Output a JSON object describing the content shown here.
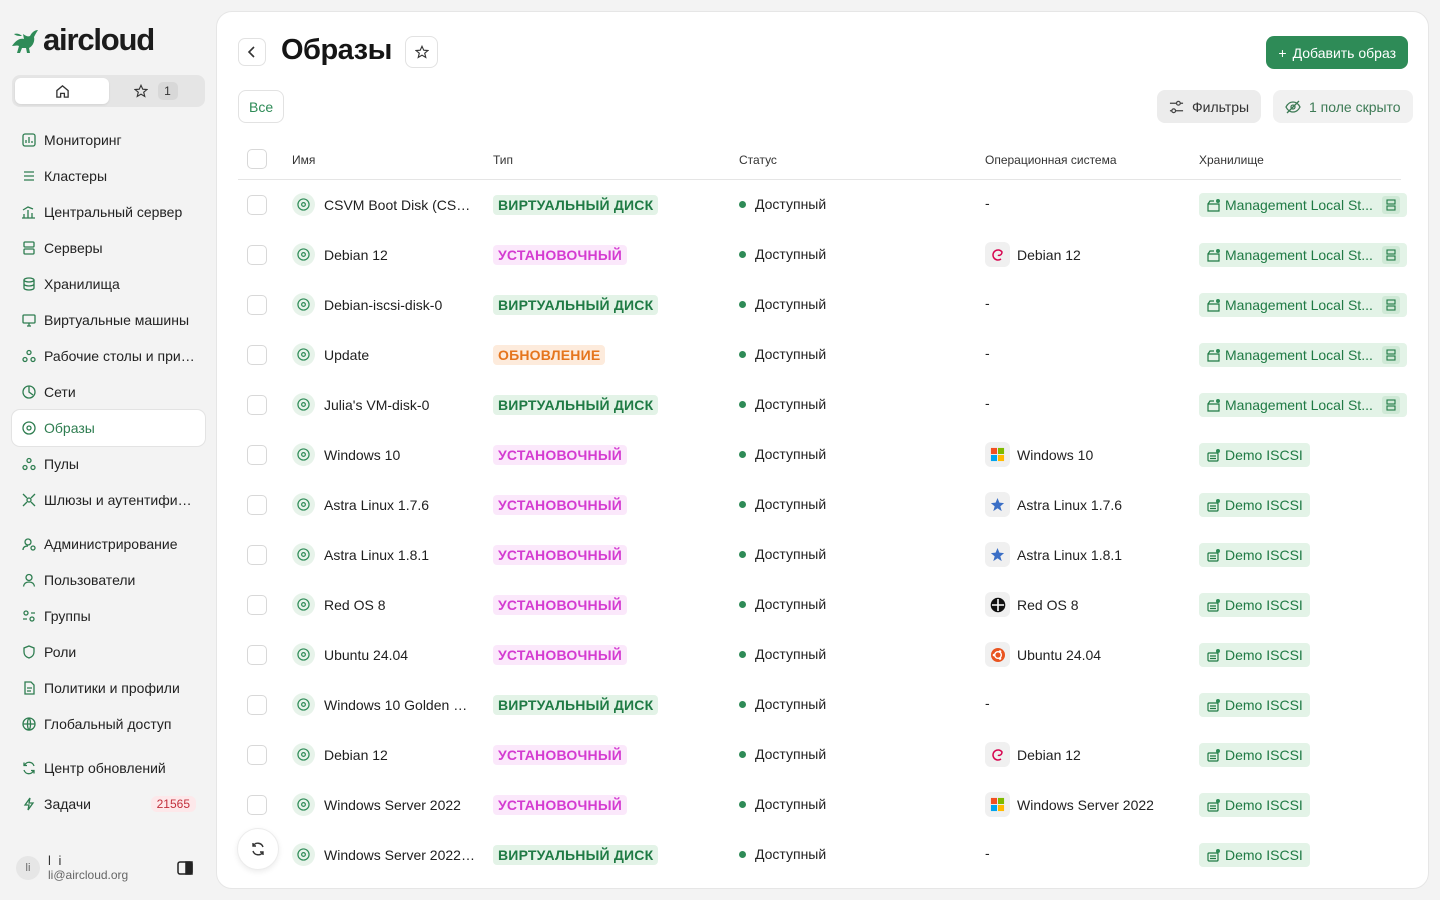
{
  "app": {
    "logo_text": "aircloud"
  },
  "topnav": {
    "favorites_count": "1"
  },
  "sidebar": {
    "items": [
      {
        "label": "Мониторинг",
        "icon": "chart-icon"
      },
      {
        "label": "Кластеры",
        "icon": "layers-icon"
      },
      {
        "label": "Центральный сервер",
        "icon": "central-server-icon"
      },
      {
        "label": "Серверы",
        "icon": "server-icon"
      },
      {
        "label": "Хранилища",
        "icon": "database-icon"
      },
      {
        "label": "Виртуальные машины",
        "icon": "monitor-icon"
      },
      {
        "label": "Рабочие столы и прил...",
        "icon": "desktops-icon"
      },
      {
        "label": "Сети",
        "icon": "network-icon"
      },
      {
        "label": "Образы",
        "icon": "image-icon",
        "active": true
      },
      {
        "label": "Пулы",
        "icon": "pools-icon"
      },
      {
        "label": "Шлюзы и аутентифика...",
        "icon": "gateway-icon"
      },
      {
        "label": "Администрирование",
        "icon": "admin-icon"
      },
      {
        "label": "Пользователи",
        "icon": "user-icon"
      },
      {
        "label": "Группы",
        "icon": "groups-icon"
      },
      {
        "label": "Роли",
        "icon": "shield-icon"
      },
      {
        "label": "Политики и профили",
        "icon": "policy-icon"
      },
      {
        "label": "Глобальный доступ",
        "icon": "globe-icon"
      },
      {
        "label": "Центр обновлений",
        "icon": "refresh-icon"
      },
      {
        "label": "Задачи",
        "icon": "bolt-icon",
        "badge": "21565"
      }
    ]
  },
  "user": {
    "initials": "li",
    "name": "l i",
    "email": "li@aircloud.org"
  },
  "page": {
    "title": "Образы",
    "add_button": "Добавить образ",
    "tab_all": "Все",
    "filters_button": "Фильтры",
    "hidden_fields_button": "1 поле скрыто"
  },
  "table": {
    "columns": [
      "Имя",
      "Тип",
      "Статус",
      "Операционная система",
      "Хранилище"
    ],
    "rows": [
      {
        "name": "CSVM Boot Disk (CSVM ...",
        "type": "ВИРТУАЛЬНЫЙ ДИСК",
        "type_kind": "disk",
        "status": "Доступный",
        "os": "-",
        "os_icon": "",
        "storage": "Management Local St...",
        "storage_kind": "local"
      },
      {
        "name": "Debian 12",
        "type": "УСТАНОВОЧНЫЙ",
        "type_kind": "inst",
        "status": "Доступный",
        "os": "Debian 12",
        "os_icon": "debian-icon",
        "storage": "Management Local St...",
        "storage_kind": "local"
      },
      {
        "name": "Debian-iscsi-disk-0",
        "type": "ВИРТУАЛЬНЫЙ ДИСК",
        "type_kind": "disk",
        "status": "Доступный",
        "os": "-",
        "os_icon": "",
        "storage": "Management Local St...",
        "storage_kind": "local"
      },
      {
        "name": "Update",
        "type": "ОБНОВЛЕНИЕ",
        "type_kind": "upd",
        "status": "Доступный",
        "os": "-",
        "os_icon": "",
        "storage": "Management Local St...",
        "storage_kind": "local"
      },
      {
        "name": "Julia's VM-disk-0",
        "type": "ВИРТУАЛЬНЫЙ ДИСК",
        "type_kind": "disk",
        "status": "Доступный",
        "os": "-",
        "os_icon": "",
        "storage": "Management Local St...",
        "storage_kind": "local"
      },
      {
        "name": "Windows 10",
        "type": "УСТАНОВОЧНЫЙ",
        "type_kind": "inst",
        "status": "Доступный",
        "os": "Windows 10",
        "os_icon": "windows-icon",
        "storage": "Demo ISCSI",
        "storage_kind": "iscsi"
      },
      {
        "name": "Astra Linux 1.7.6",
        "type": "УСТАНОВОЧНЫЙ",
        "type_kind": "inst",
        "status": "Доступный",
        "os": "Astra Linux 1.7.6",
        "os_icon": "astra-icon",
        "storage": "Demo ISCSI",
        "storage_kind": "iscsi"
      },
      {
        "name": "Astra Linux 1.8.1",
        "type": "УСТАНОВОЧНЫЙ",
        "type_kind": "inst",
        "status": "Доступный",
        "os": "Astra Linux 1.8.1",
        "os_icon": "astra-icon",
        "storage": "Demo ISCSI",
        "storage_kind": "iscsi"
      },
      {
        "name": "Red OS 8",
        "type": "УСТАНОВОЧНЫЙ",
        "type_kind": "inst",
        "status": "Доступный",
        "os": "Red OS 8",
        "os_icon": "redos-icon",
        "storage": "Demo ISCSI",
        "storage_kind": "iscsi"
      },
      {
        "name": "Ubuntu 24.04",
        "type": "УСТАНОВОЧНЫЙ",
        "type_kind": "inst",
        "status": "Доступный",
        "os": "Ubuntu 24.04",
        "os_icon": "ubuntu-icon",
        "storage": "Demo ISCSI",
        "storage_kind": "iscsi"
      },
      {
        "name": "Windows 10 Golden VM...",
        "type": "ВИРТУАЛЬНЫЙ ДИСК",
        "type_kind": "disk",
        "status": "Доступный",
        "os": "-",
        "os_icon": "",
        "storage": "Demo ISCSI",
        "storage_kind": "iscsi"
      },
      {
        "name": "Debian 12",
        "type": "УСТАНОВОЧНЫЙ",
        "type_kind": "inst",
        "status": "Доступный",
        "os": "Debian 12",
        "os_icon": "debian-icon",
        "storage": "Demo ISCSI",
        "storage_kind": "iscsi"
      },
      {
        "name": "Windows Server 2022",
        "type": "УСТАНОВОЧНЫЙ",
        "type_kind": "inst",
        "status": "Доступный",
        "os": "Windows Server 2022",
        "os_icon": "windows-icon",
        "storage": "Demo ISCSI",
        "storage_kind": "iscsi"
      },
      {
        "name": "Windows Server 2022-...",
        "type": "ВИРТУАЛЬНЫЙ ДИСК",
        "type_kind": "disk",
        "status": "Доступный",
        "os": "-",
        "os_icon": "",
        "storage": "Demo ISCSI",
        "storage_kind": "iscsi"
      }
    ]
  },
  "colors": {
    "accent": "#2e8b57",
    "disk_badge": "#1f7a44",
    "install_badge": "#d43bd1",
    "update_badge": "#e5751d",
    "task_badge": "#c2303c"
  }
}
